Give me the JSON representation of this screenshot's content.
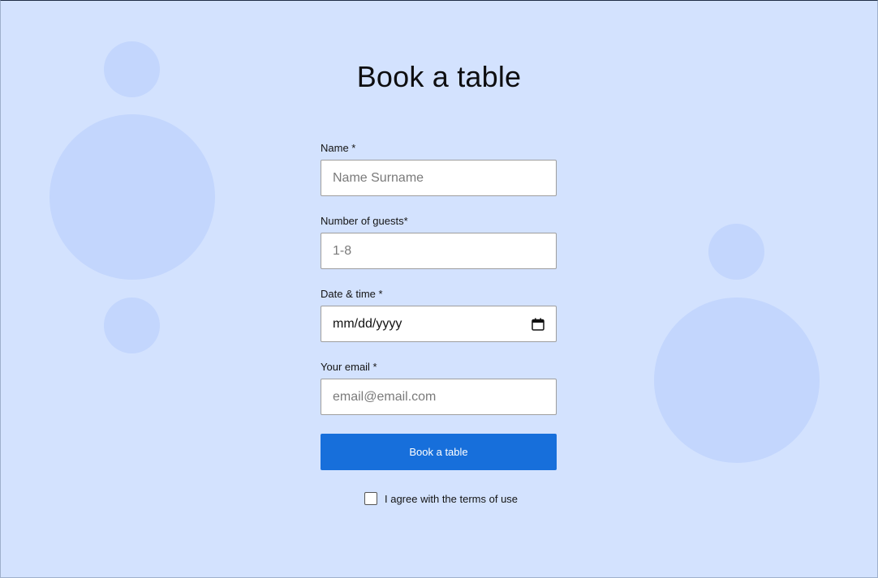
{
  "form": {
    "title": "Book a table",
    "name": {
      "label": "Name *",
      "placeholder": "Name Surname"
    },
    "guests": {
      "label": "Number of guests*",
      "placeholder": "1-8"
    },
    "datetime": {
      "label": "Date & time *",
      "value": "mm/dd/yyyy",
      "icon": "calendar-icon"
    },
    "email": {
      "label": "Your email *",
      "placeholder": "email@email.com"
    },
    "submit_label": "Book a table",
    "terms_label": "I agree with the terms of use",
    "terms_checked": false
  },
  "colors": {
    "background": "#d3e2fe",
    "circles": "#c3d6fd",
    "button": "#176fdb"
  }
}
